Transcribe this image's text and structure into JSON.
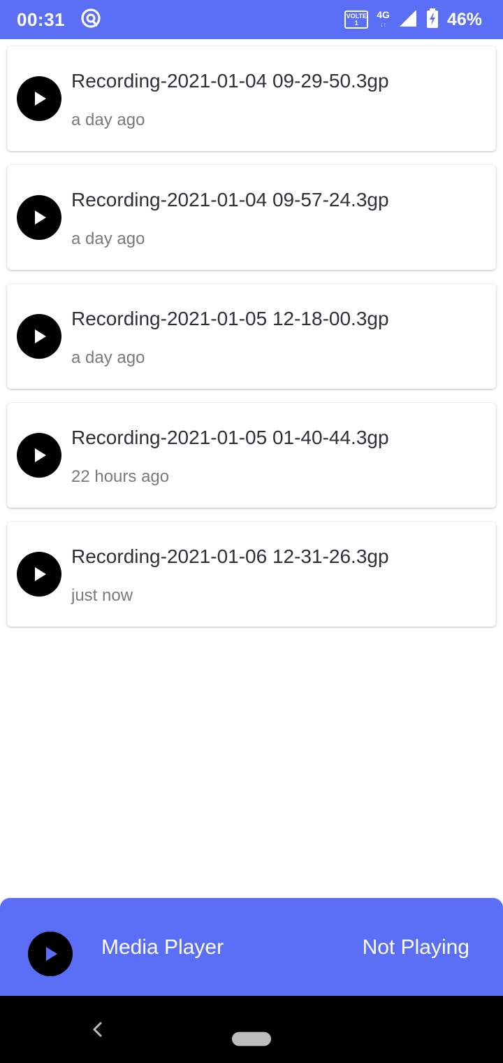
{
  "status_bar": {
    "time": "00:31",
    "volte_top": "VOLTE",
    "volte_bottom": "1",
    "network_type": "4G",
    "network_arrows": "↓↑",
    "battery_percent": "46%",
    "icons": [
      "at-sign-icon",
      "volte-icon",
      "signal-icon",
      "battery-charging-icon"
    ]
  },
  "recordings": [
    {
      "name": "Recording-2021-01-04 09-29-50.3gp",
      "time": "a day ago",
      "icon": "play-icon"
    },
    {
      "name": "Recording-2021-01-04 09-57-24.3gp",
      "time": "a day ago",
      "icon": "play-icon"
    },
    {
      "name": "Recording-2021-01-05 12-18-00.3gp",
      "time": "a day ago",
      "icon": "play-icon"
    },
    {
      "name": "Recording-2021-01-05 01-40-44.3gp",
      "time": "22 hours ago",
      "icon": "play-icon"
    },
    {
      "name": "Recording-2021-01-06 12-31-26.3gp",
      "time": "just now",
      "icon": "play-icon"
    }
  ],
  "media_player": {
    "title": "Media Player",
    "status": "Not Playing",
    "icon": "play-icon"
  },
  "nav_bar": {
    "icons": [
      "back-icon",
      "home-pill-icon"
    ]
  },
  "colors": {
    "accent": "#5a6ef6",
    "play_button": "#000000",
    "media_player_play_glyph": "#5a6ef6",
    "card_title": "#2f3037",
    "card_subtitle": "#7a7a7a"
  }
}
